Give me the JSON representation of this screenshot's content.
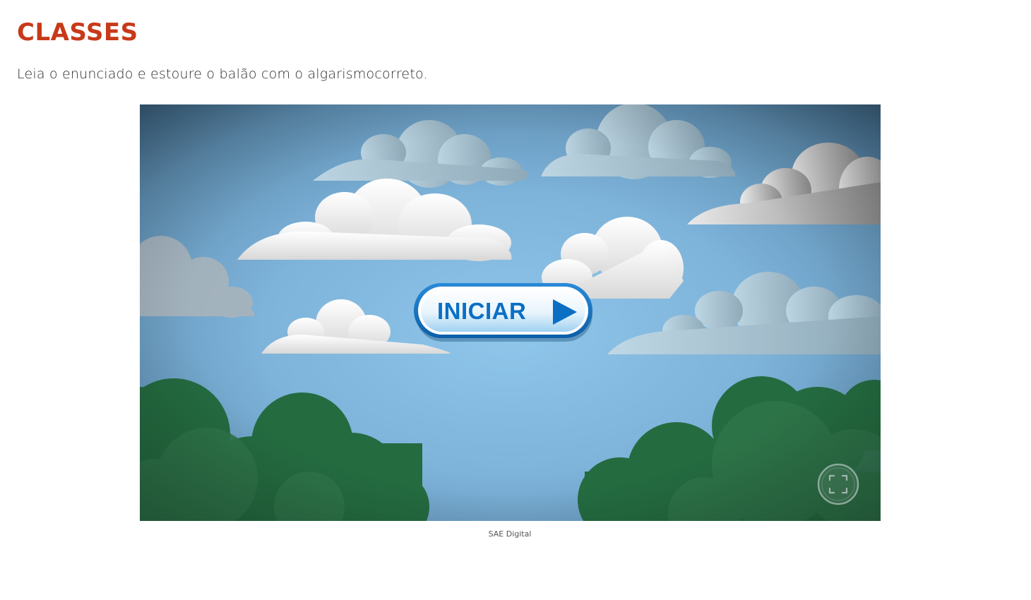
{
  "page": {
    "title": "CLASSES",
    "instruction": "Leia o enunciado e estoure o balão com o algarismocorreto."
  },
  "game": {
    "start_button_label": "INICIAR",
    "start_button_icon": "play-triangle-icon",
    "fullscreen_icon": "fullscreen-corners-icon",
    "colors": {
      "sky_center": "#8ec5ea",
      "sky_edge": "#3f6c8c",
      "foliage": "#246b40",
      "title": "#c8391a",
      "button_text": "#0b6fc4"
    }
  },
  "caption": "SAE Digital"
}
